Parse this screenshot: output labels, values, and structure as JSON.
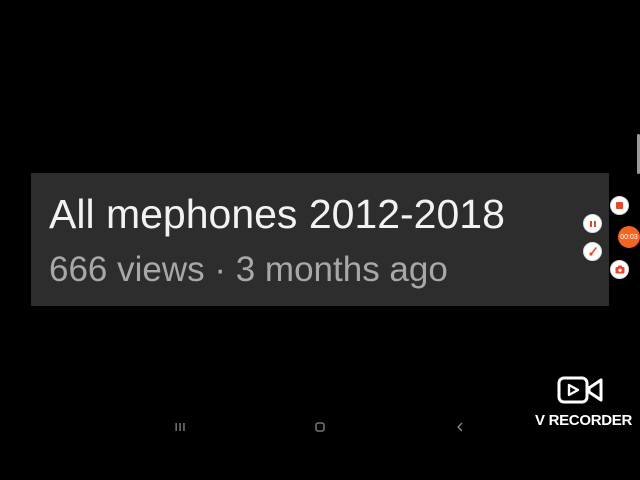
{
  "video": {
    "title": "All mephones 2012-2018",
    "meta": "666 views · 3 months ago"
  },
  "recorder": {
    "timer": "00:03",
    "brand": "V RECORDER",
    "accent_color": "#f26522",
    "controls": [
      "stop-icon",
      "pause-icon",
      "brush-icon",
      "camera-icon"
    ]
  },
  "navbar": {
    "icons": [
      "recent-apps-icon",
      "home-icon",
      "back-icon"
    ]
  }
}
